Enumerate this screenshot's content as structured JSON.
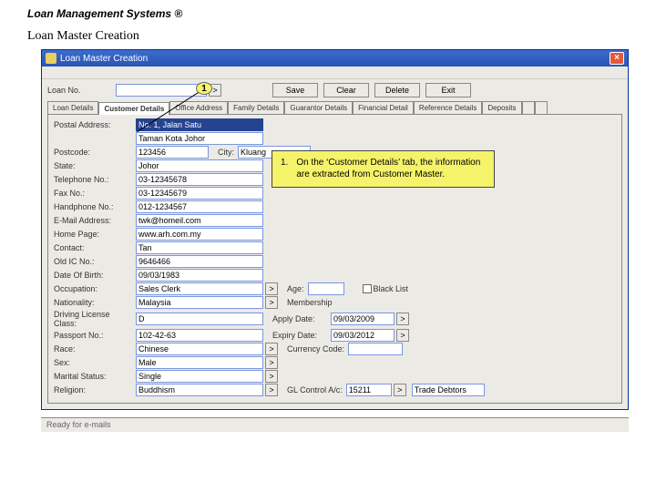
{
  "doc": {
    "title": "Loan Management Systems ®",
    "subtitle": "Loan Master Creation"
  },
  "window": {
    "title": "Loan Master Creation",
    "close": "×",
    "toolbar": {
      "loan_no_label": "Loan No.",
      "loan_no_value": "",
      "save": "Save",
      "clear": "Clear",
      "delete": "Delete",
      "exit": "Exit"
    },
    "tabs": {
      "items": [
        {
          "label": "Loan Details"
        },
        {
          "label": "Customer Details"
        },
        {
          "label": "Office Address"
        },
        {
          "label": "Family Details"
        },
        {
          "label": "Guarantor Details"
        },
        {
          "label": "Financial Detail"
        },
        {
          "label": "Reference Details"
        },
        {
          "label": "Deposits"
        }
      ],
      "active_index": 1
    },
    "customer_details": {
      "postal_address_label": "Postal Address:",
      "postal_line1": "No. 1, Jalan Satu",
      "postal_line2": "Taman Kota Johor",
      "postcode_label": "Postcode:",
      "postcode": "123456",
      "city_label": "City:",
      "city": "Kluang",
      "state_label": "State:",
      "state": "Johor",
      "telephone_label": "Telephone No.:",
      "telephone": "03-12345678",
      "fax_label": "Fax No.:",
      "fax": "03-12345679",
      "handphone_label": "Handphone No.:",
      "handphone": "012-1234567",
      "email_label": "E-Mail Address:",
      "email": "twk@homeil.com",
      "homepage_label": "Home Page:",
      "homepage": "www.arh.com.my",
      "contact_label": "Contact:",
      "contact": "Tan",
      "oldic_label": "Old IC No.:",
      "oldic": "9646466",
      "dob_label": "Date Of Birth:",
      "dob": "09/03/1983",
      "occupation_label": "Occupation:",
      "occupation": "Sales Clerk",
      "age_label": "Age:",
      "age": "",
      "blacklist_label": "Black List",
      "nationality_label": "Nationality:",
      "nationality": "Malaysia",
      "membership_label": "Membership",
      "apply_date_label": "Apply Date:",
      "apply_date": "09/03/2009",
      "expiry_date_label": "Expiry Date:",
      "expiry_date": "09/03/2012",
      "license_label": "Driving License Class:",
      "license": "D",
      "passport_label": "Passport No.:",
      "passport": "102-42-63",
      "race_label": "Race:",
      "race": "Chinese",
      "currency_label": "Currency Code:",
      "currency": "",
      "sex_label": "Sex:",
      "sex": "Male",
      "marital_label": "Marital Status:",
      "marital": "Single",
      "religion_label": "Religion:",
      "religion": "Buddhism",
      "glcontrol_label": "GL Control A/c:",
      "glcontrol": "15211",
      "glcontrol_desc": "Trade Debtors"
    },
    "status": "Ready for e-mails"
  },
  "annotation": {
    "badge": "1",
    "num": "1.",
    "text": "On the ‘Customer Details’ tab, the information are extracted from Customer Master."
  }
}
